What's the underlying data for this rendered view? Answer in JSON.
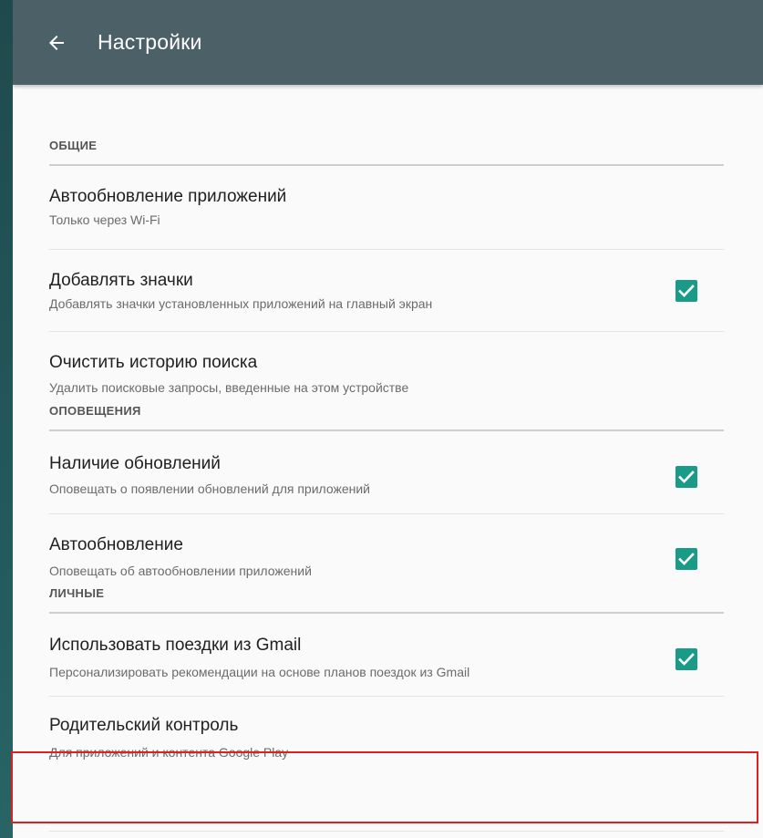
{
  "toolbar": {
    "title": "Настройки",
    "back_icon": "arrow-back-icon"
  },
  "sections": [
    {
      "header": "ОБЩИЕ",
      "items": [
        {
          "title": "Автообновление приложений",
          "summary": "Только через Wi-Fi",
          "checkbox": null
        },
        {
          "title": "Добавлять значки",
          "summary": "Добавлять значки установленных приложений на главный экран",
          "checkbox": true
        },
        {
          "title": "Очистить историю поиска",
          "summary": "Удалить поисковые запросы, введенные на этом устройстве",
          "checkbox": null
        }
      ]
    },
    {
      "header": "ОПОВЕЩЕНИЯ",
      "items": [
        {
          "title": "Наличие обновлений",
          "summary": "Оповещать о появлении обновлений для приложений",
          "checkbox": true
        },
        {
          "title": "Автообновление",
          "summary": "Оповещать об автообновлении приложений",
          "checkbox": true
        }
      ]
    },
    {
      "header": "ЛИЧНЫЕ",
      "items": [
        {
          "title": "Использовать поездки из Gmail",
          "summary": "Персонализировать рекомендации на основе планов поездок из Gmail",
          "checkbox": true
        },
        {
          "title": "Родительский контроль",
          "summary": "Для приложений и контента Google Play",
          "checkbox": null
        }
      ]
    }
  ],
  "colors": {
    "toolbar": "#4c6068",
    "checkbox": "#1a9b88",
    "highlight": "#e02020"
  }
}
